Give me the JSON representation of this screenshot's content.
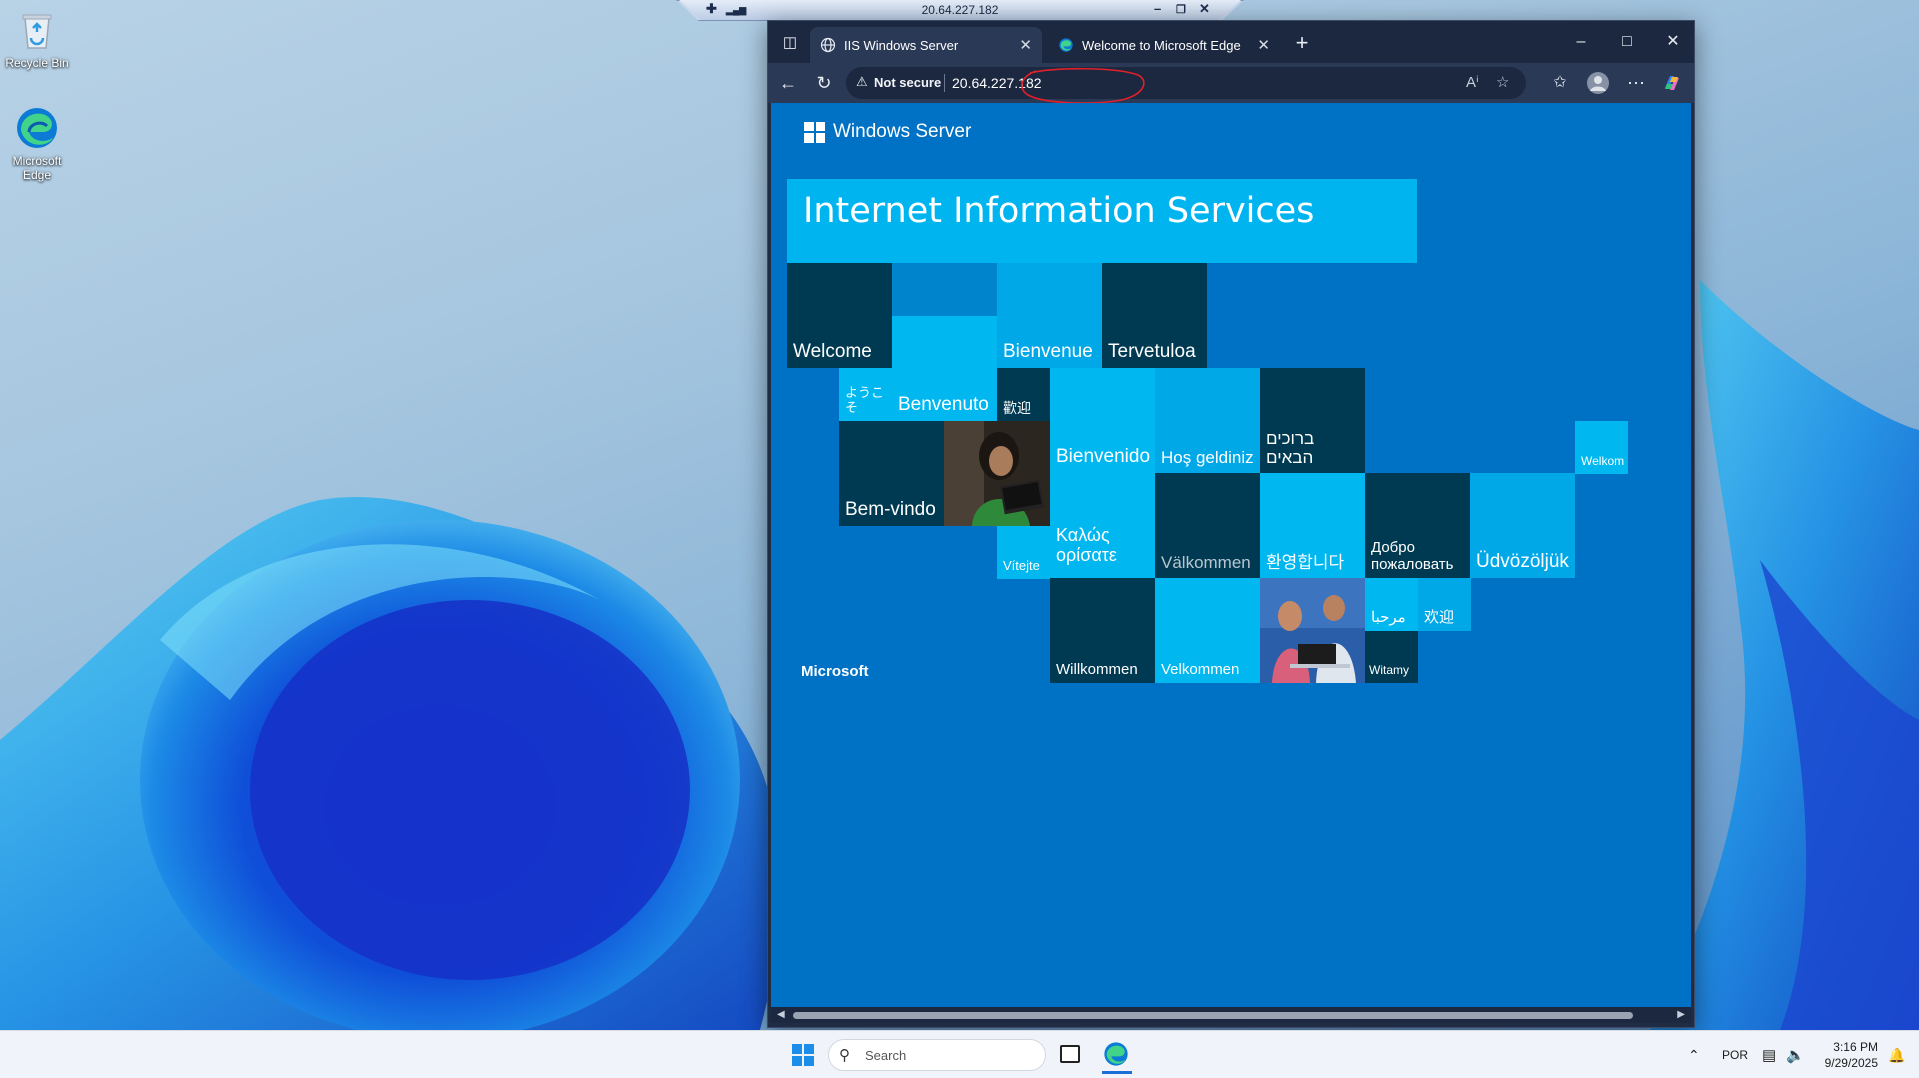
{
  "desktop": {
    "icons": [
      {
        "label": "Recycle Bin",
        "icon": "recycle-bin-icon"
      },
      {
        "label": "Microsoft Edge",
        "icon": "edge-icon"
      }
    ]
  },
  "rdp_bar": {
    "title": "20.64.227.182",
    "pin": "✚",
    "signal": "▂▄▆",
    "minimize": "–",
    "restore": "❐",
    "close": "✕"
  },
  "browser": {
    "tabs": [
      {
        "label": "IIS Windows Server",
        "icon": "globe-icon",
        "active": true
      },
      {
        "label": "Welcome to Microsoft Edge",
        "icon": "edge-icon",
        "active": false
      }
    ],
    "new_tab": "+",
    "address": {
      "security_label": "Not secure",
      "url": "20.64.227.182"
    },
    "window_controls": {
      "minimize": "–",
      "maximize": "□",
      "close": "✕"
    },
    "colors": {
      "frame": "#202c43",
      "toolbar": "#2a3956",
      "annotation": "#e0202a"
    }
  },
  "page": {
    "logo_text": "Windows Server",
    "banner": "Internet Information Services",
    "footer_brand": "Microsoft",
    "greetings": {
      "welcome": "Welcome",
      "bienvenue": "Bienvenue",
      "tervetuloa": "Tervetuloa",
      "youkoso": "ようこそ",
      "benvenuto": "Benvenuto",
      "kangei": "歡迎",
      "bienvenido": "Bienvenido",
      "hos_geldiniz": "Hoş geldiniz",
      "hebrew": "ברוכים הבאים",
      "welkom": "Welkom",
      "bem_vindo": "Bem-vindo",
      "vitejte": "Vítejte",
      "greek": "Καλώς ορίσατε",
      "valkommen": "Välkommen",
      "korean": "환영합니다",
      "russian": "Добро пожаловать",
      "udvozoljuk": "Üdvözöljük",
      "arabic": "مرحبا",
      "huanying": "欢迎",
      "willkommen": "Willkommen",
      "velkommen": "Velkommen",
      "witamy": "Witamy"
    },
    "colors": {
      "background": "#0072c6",
      "banner": "#00b4f0",
      "dark_tile": "#003a52",
      "light_tile": "#00b7f0"
    }
  },
  "taskbar": {
    "search_placeholder": "Search",
    "language": "POR",
    "time": "3:16 PM",
    "date": "9/29/2025"
  }
}
